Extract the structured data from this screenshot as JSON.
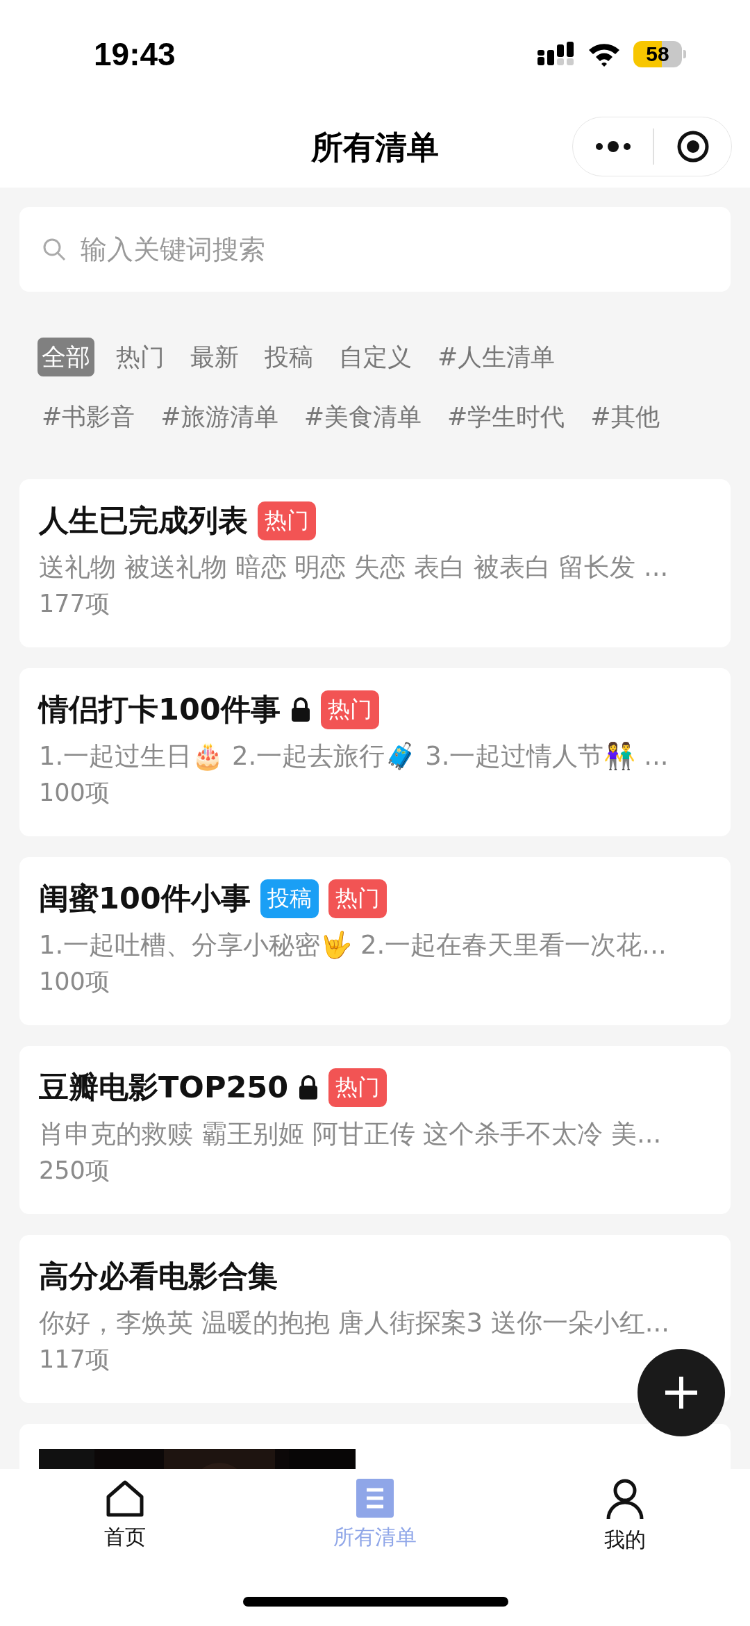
{
  "status_bar": {
    "time": "19:43",
    "battery": "58"
  },
  "nav_bar": {
    "title": "所有清单"
  },
  "search": {
    "placeholder": "输入关键词搜索"
  },
  "filter_rows": [
    [
      {
        "label": "全部",
        "selected": true
      },
      {
        "label": "热门",
        "selected": false
      },
      {
        "label": "最新",
        "selected": false
      },
      {
        "label": "投稿",
        "selected": false
      },
      {
        "label": "自定义",
        "selected": false
      },
      {
        "label": "#人生清单",
        "selected": false
      }
    ],
    [
      {
        "label": "#书影音",
        "selected": false
      },
      {
        "label": "#旅游清单",
        "selected": false
      },
      {
        "label": "#美食清单",
        "selected": false
      },
      {
        "label": "#学生时代",
        "selected": false
      },
      {
        "label": "#其他",
        "selected": false
      }
    ]
  ],
  "lists": [
    {
      "kind": "list",
      "title": "人生已完成列表",
      "locked": false,
      "badges": [
        {
          "kind": "hot",
          "label": "热门"
        }
      ],
      "summary": "送礼物 被送礼物 暗恋 明恋 失恋 表白 被表白 留长发 ...",
      "count": "177项"
    },
    {
      "kind": "list",
      "title": "情侣打卡100件事",
      "locked": true,
      "badges": [
        {
          "kind": "hot",
          "label": "热门"
        }
      ],
      "summary": "1.一起过生日🎂 2.一起去旅行🧳 3.一起过情人节👫 ...",
      "count": "100项"
    },
    {
      "kind": "list",
      "title": "闺蜜100件小事",
      "locked": false,
      "badges": [
        {
          "kind": "submitted",
          "label": "投稿"
        },
        {
          "kind": "hot",
          "label": "热门"
        }
      ],
      "summary": "1.一起吐槽、分享小秘密🤟 2.一起在春天里看一次花...",
      "count": "100项"
    },
    {
      "kind": "list",
      "title": "豆瓣电影TOP250",
      "locked": true,
      "badges": [
        {
          "kind": "hot",
          "label": "热门"
        }
      ],
      "summary": "肖申克的救赎 霸王别姬 阿甘正传 这个杀手不太冷 美...",
      "count": "250项"
    },
    {
      "kind": "list",
      "title": "高分必看电影合集",
      "locked": false,
      "summary": "你好，李焕英 温暖的抱抱 唐人街探案3 送你一朵小红...",
      "count": "117项"
    },
    {
      "kind": "ad"
    }
  ],
  "tab_bar": [
    {
      "kind": "home",
      "label": "首页",
      "selected": false
    },
    {
      "kind": "list",
      "label": "所有清单",
      "selected": true
    },
    {
      "kind": "profile",
      "label": "我的",
      "selected": false
    }
  ]
}
